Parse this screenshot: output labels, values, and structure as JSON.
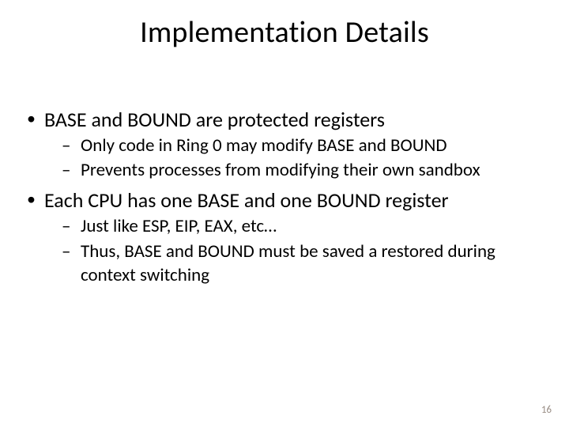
{
  "slide": {
    "title": "Implementation Details",
    "bullets": [
      {
        "text": "BASE and BOUND are protected registers",
        "sub": [
          "Only code in Ring 0 may modify BASE and BOUND",
          "Prevents processes from modifying their own sandbox"
        ]
      },
      {
        "text": "Each CPU has one BASE and one BOUND register",
        "sub": [
          "Just like ESP, EIP, EAX, etc…",
          "Thus, BASE and BOUND must be saved a restored during context switching"
        ]
      }
    ],
    "page_number": "16"
  }
}
